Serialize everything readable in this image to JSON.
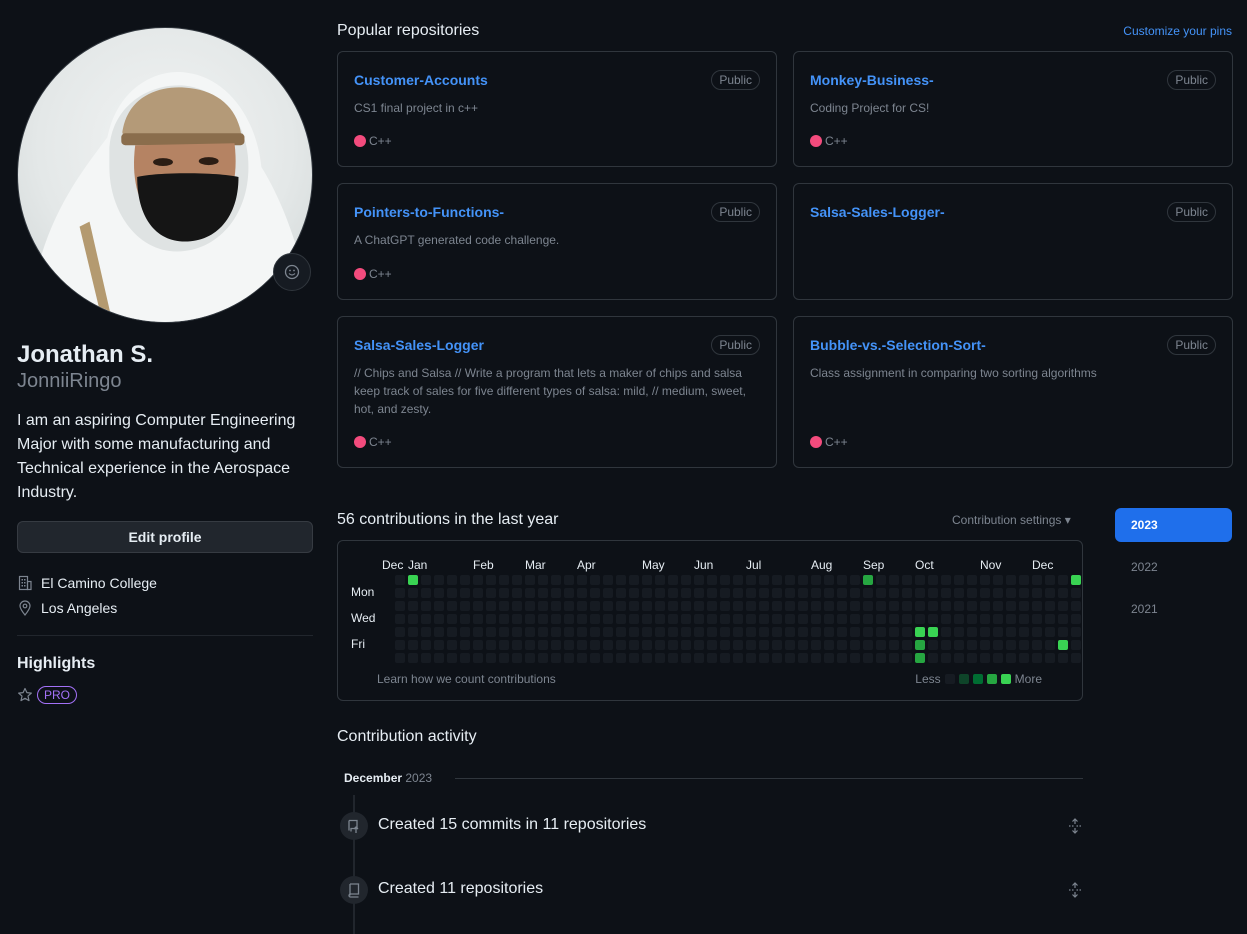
{
  "profile": {
    "full_name": "Jonathan S.",
    "username": "JonniiRingo",
    "bio": "I am an aspiring Computer Engineering Major with some manufacturing and Technical experience in the Aerospace Industry.",
    "edit_label": "Edit profile",
    "org": "El Camino College",
    "location": "Los Angeles",
    "highlights_title": "Highlights",
    "pro_badge": "PRO"
  },
  "pinned": {
    "title": "Popular repositories",
    "customize_label": "Customize your pins",
    "repos": [
      {
        "name": "Customer-Accounts",
        "visibility": "Public",
        "description": "CS1 final project in c++",
        "language": "C++"
      },
      {
        "name": "Monkey-Business-",
        "visibility": "Public",
        "description": "Coding Project for CS!",
        "language": "C++"
      },
      {
        "name": "Pointers-to-Functions-",
        "visibility": "Public",
        "description": "A ChatGPT generated code challenge.",
        "language": "C++"
      },
      {
        "name": "Salsa-Sales-Logger-",
        "visibility": "Public",
        "description": "",
        "language": ""
      },
      {
        "name": "Salsa-Sales-Logger",
        "visibility": "Public",
        "description": "// Chips and Salsa // Write a program that lets a maker of chips and salsa keep track of sales for five different types of salsa: mild, // medium, sweet, hot, and zesty.",
        "language": "C++"
      },
      {
        "name": "Bubble-vs.-Selection-Sort-",
        "visibility": "Public",
        "description": "Class assignment in comparing two sorting algorithms",
        "language": "C++"
      }
    ]
  },
  "contributions": {
    "title": "56 contributions in the last year",
    "settings_label": "Contribution settings ▾",
    "months": [
      "Dec",
      "Jan",
      "Feb",
      "Mar",
      "Apr",
      "May",
      "Jun",
      "Jul",
      "Aug",
      "Sep",
      "Oct",
      "Nov",
      "Dec"
    ],
    "days": [
      "Mon",
      "Wed",
      "Fri"
    ],
    "learn_label": "Learn how we count contributions",
    "legend_less": "Less",
    "legend_more": "More",
    "levels_colors": [
      "#161b22",
      "#0e4429",
      "#006d32",
      "#26a641",
      "#39d353"
    ],
    "active_cells": [
      {
        "week": 1,
        "day": 0,
        "level": 4
      },
      {
        "week": 36,
        "day": 0,
        "level": 3
      },
      {
        "week": 40,
        "day": 4,
        "level": 4
      },
      {
        "week": 41,
        "day": 4,
        "level": 4
      },
      {
        "week": 40,
        "day": 5,
        "level": 3
      },
      {
        "week": 40,
        "day": 6,
        "level": 3
      },
      {
        "week": 40,
        "day": 7,
        "level": 3
      },
      {
        "week": 52,
        "day": 0,
        "level": 4
      },
      {
        "week": 51,
        "day": 5,
        "level": 4
      }
    ],
    "years": [
      "2023",
      "2022",
      "2021"
    ],
    "active_year": "2023"
  },
  "activity": {
    "title": "Contribution activity",
    "month": "December",
    "year": "2023",
    "items": [
      {
        "text": "Created 15 commits in 11 repositories",
        "icon": "repo-push-icon"
      },
      {
        "text": "Created 11 repositories",
        "icon": "repo-icon"
      }
    ]
  }
}
